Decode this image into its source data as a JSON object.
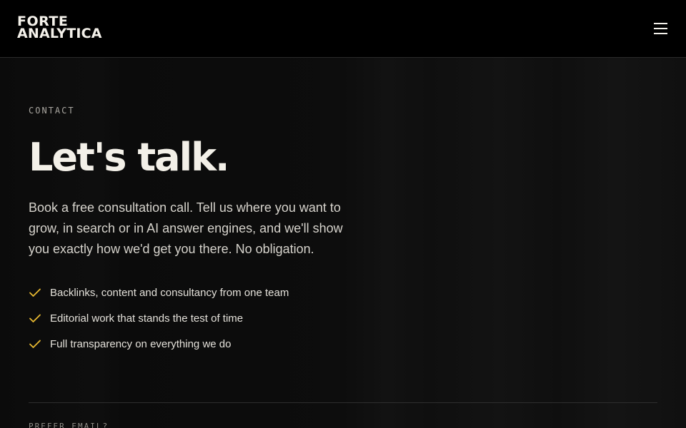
{
  "header": {
    "logo_line1": "FORTE",
    "logo_line2": "ANALYTICA",
    "menu_icon": "hamburger-menu-icon"
  },
  "hero": {
    "eyebrow": "CONTACT",
    "title": "Let's talk.",
    "lead": "Book a free consultation call. Tell us where you want to grow, in search or in AI answer engines, and we'll show you exactly how we'd get you there. No obligation."
  },
  "features": [
    {
      "icon": "check-icon",
      "text": "Backlinks, content and consultancy from one team"
    },
    {
      "icon": "check-icon",
      "text": "Editorial work that stands the test of time"
    },
    {
      "icon": "check-icon",
      "text": "Full transparency on everything we do"
    }
  ],
  "email_section": {
    "label": "PREFER EMAIL?"
  },
  "colors": {
    "background": "#0c0c0c",
    "header": "#000000",
    "text": "#f3f0e8",
    "accent_check": "#e8b931"
  }
}
